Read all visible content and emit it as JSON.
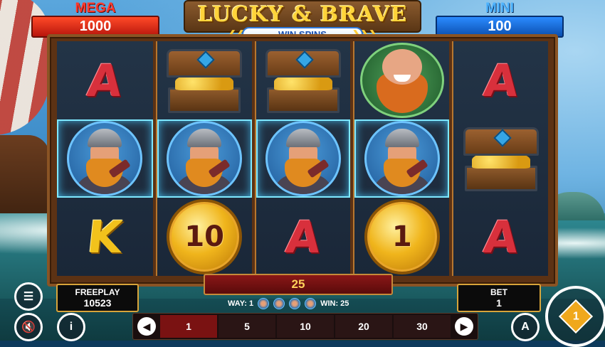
{
  "jackpots": {
    "mega": {
      "label": "MEGA",
      "value": "1000"
    },
    "mini": {
      "label": "MINI",
      "value": "100"
    }
  },
  "logo": {
    "title": "LUCKY & BRAVE",
    "subtitle": "WIN SPINS"
  },
  "reels": [
    [
      "A",
      "viking",
      "K"
    ],
    [
      "chest",
      "viking",
      "coin-10"
    ],
    [
      "chest",
      "viking",
      "A"
    ],
    [
      "dwarf",
      "viking",
      "coin-1"
    ],
    [
      "A",
      "chest",
      "A"
    ]
  ],
  "coins": {
    "c1": "10",
    "c2": "1"
  },
  "letters": {
    "a": "A",
    "k": "K"
  },
  "win_amount": "25",
  "freeplay": {
    "label": "FREEPLAY",
    "value": "10523"
  },
  "bet": {
    "label": "BET",
    "value": "1"
  },
  "way_info": {
    "way_label": "WAY: 1",
    "win_label": "WIN: 25"
  },
  "bet_options": [
    "1",
    "5",
    "10",
    "20",
    "30"
  ],
  "selected_bet": "1",
  "buttons": {
    "info": "i",
    "auto": "A",
    "spin_level": "1"
  },
  "colors": {
    "mega": "#ff3a2e",
    "mini": "#4fb4ff",
    "win_highlight": "#7fe9ff",
    "gold": "#f0b51c"
  }
}
